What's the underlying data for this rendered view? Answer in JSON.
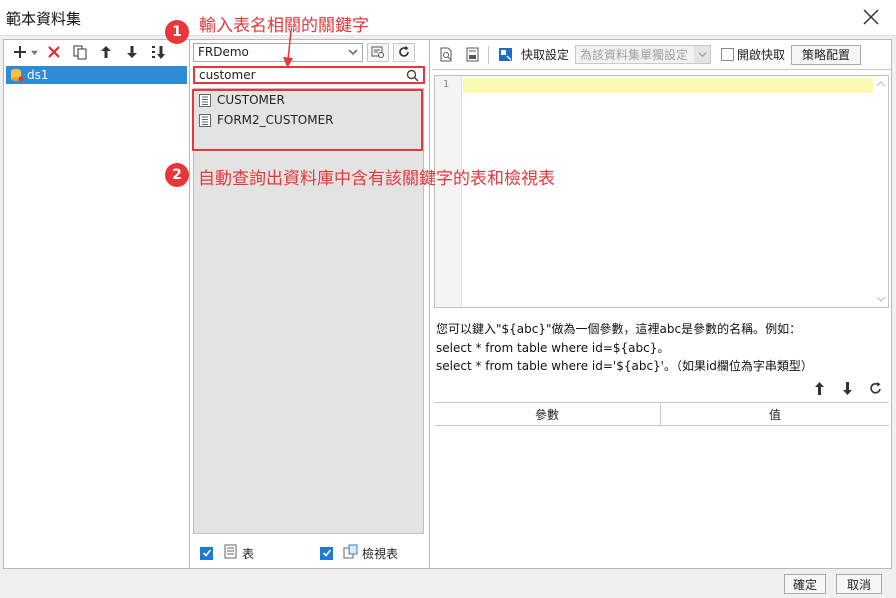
{
  "window": {
    "title": "範本資料集",
    "close_icon": "close-icon"
  },
  "left": {
    "datasets": [
      "ds1"
    ]
  },
  "middle": {
    "connection": "FRDemo",
    "search_value": "customer",
    "tables": [
      "CUSTOMER",
      "FORM2_CUSTOMER"
    ],
    "footer": {
      "table_label": "表",
      "view_label": "檢視表"
    }
  },
  "right": {
    "toolbar": {
      "quick_fetch_label": "快取設定",
      "cache_select": "為該資料集單獨設定",
      "enable_cache_label": "開啟快取",
      "strategy_button": "策略配置"
    },
    "editor": {
      "line_numbers": [
        "1"
      ]
    },
    "hint_lines": [
      "您可以鍵入\"${abc}\"做為一個參數，這裡abc是參數的名稱。例如：",
      "select * from table where id=${abc}。",
      "select * from table where id='${abc}'。（如果id欄位為字串類型）"
    ],
    "param_table": {
      "columns": [
        "參數",
        "值"
      ]
    }
  },
  "bottom": {
    "ok_label": "確定",
    "cancel_label": "取消"
  },
  "annotations": {
    "step1_number": "1",
    "step1_text": "輸入表名相關的關鍵字",
    "step2_number": "2",
    "step2_text": "自動查詢出資料庫中含有該關鍵字的表和檢視表"
  },
  "colors": {
    "annotation_red": "#e8363a",
    "selection_blue": "#2e8bd8",
    "editor_highlight": "#fbfab3"
  }
}
